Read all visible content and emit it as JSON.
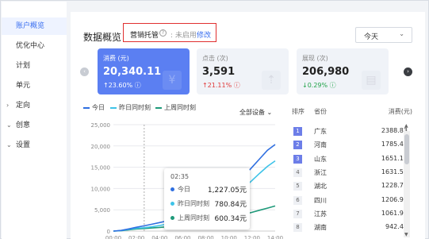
{
  "sidebar": {
    "items": [
      {
        "label": "账户概览",
        "active": true,
        "chevron": ""
      },
      {
        "label": "优化中心",
        "active": false,
        "chevron": ""
      },
      {
        "label": "计划",
        "active": false,
        "chevron": ""
      },
      {
        "label": "单元",
        "active": false,
        "chevron": ""
      },
      {
        "label": "定向",
        "active": false,
        "chevron": "›"
      },
      {
        "label": "创意",
        "active": false,
        "chevron": "⌄"
      },
      {
        "label": "设置",
        "active": false,
        "chevron": "⌄"
      }
    ]
  },
  "header": {
    "title": "数据概览",
    "hosting_label": "营销托管",
    "hosting_help": "?",
    "hosting_status": ": 未启用",
    "hosting_modify": "修改",
    "date_range": "今天",
    "date_arrow": "⌄"
  },
  "metrics": [
    {
      "label": "消费 (元)",
      "value": "20,340.11",
      "change": "↑23.60%",
      "change_note": "ⓘ",
      "direction": "up",
      "icon": "¥"
    },
    {
      "label": "点击 (次)",
      "value": "3,591",
      "change": "↑21.11%",
      "change_note": "ⓘ",
      "direction": "up",
      "icon": "⇡"
    },
    {
      "label": "展现 (次)",
      "value": "206,980",
      "change": "↓0.29%",
      "change_note": "ⓘ",
      "direction": "down",
      "icon": "▤"
    }
  ],
  "nav": {
    "prev": "‹",
    "next": "›"
  },
  "legend": {
    "items": [
      {
        "label": "今日",
        "color": "#2f6fe0"
      },
      {
        "label": "昨日同时刻",
        "color": "#3ec3e8"
      },
      {
        "label": "上周同时刻",
        "color": "#1f9a7a"
      }
    ],
    "device": "全部设备 ⌄"
  },
  "chart_data": {
    "type": "line",
    "x": [
      "00:00",
      "02:00",
      "04:00",
      "06:00",
      "08:00",
      "10:00",
      "12:00",
      "14:00"
    ],
    "ylim": [
      0,
      25000
    ],
    "yticks": [
      0,
      5000,
      10000,
      15000,
      20000,
      25000
    ],
    "ytick_labels": [
      "0",
      "5,000",
      "10,000",
      "15,000",
      "20,000",
      "25,000"
    ],
    "series": [
      {
        "name": "今日",
        "color": "#2f6fe0",
        "points": [
          [
            0,
            0
          ],
          [
            1,
            150
          ],
          [
            2,
            500
          ],
          [
            3,
            900
          ],
          [
            4,
            1227
          ],
          [
            5,
            1600
          ],
          [
            6,
            2000
          ],
          [
            7,
            2400
          ],
          [
            8,
            2900
          ],
          [
            9,
            3400
          ],
          [
            10,
            4000
          ],
          [
            11,
            4700
          ],
          [
            12,
            5500
          ],
          [
            13,
            6500
          ],
          [
            14,
            7700
          ],
          [
            15,
            9200
          ],
          [
            16,
            11000
          ],
          [
            17,
            13000
          ],
          [
            18,
            15000
          ],
          [
            19,
            17000
          ],
          [
            20,
            19000
          ],
          [
            21,
            20340
          ]
        ]
      },
      {
        "name": "昨日同时刻",
        "color": "#3ec3e8",
        "points": [
          [
            0,
            0
          ],
          [
            1,
            100
          ],
          [
            2,
            380
          ],
          [
            3,
            650
          ],
          [
            4,
            780
          ],
          [
            5,
            1000
          ],
          [
            6,
            1300
          ],
          [
            7,
            1650
          ],
          [
            8,
            2050
          ],
          [
            9,
            2500
          ],
          [
            10,
            3050
          ],
          [
            11,
            3650
          ],
          [
            12,
            4300
          ],
          [
            13,
            5100
          ],
          [
            14,
            6100
          ],
          [
            15,
            7300
          ],
          [
            16,
            8700
          ],
          [
            17,
            10200
          ],
          [
            18,
            11900
          ],
          [
            19,
            13600
          ],
          [
            20,
            15200
          ],
          [
            21,
            16500
          ]
        ]
      },
      {
        "name": "上周同时刻",
        "color": "#1f9a7a",
        "points": [
          [
            0,
            0
          ],
          [
            1,
            80
          ],
          [
            2,
            300
          ],
          [
            3,
            500
          ],
          [
            4,
            600
          ],
          [
            5,
            720
          ],
          [
            6,
            850
          ],
          [
            7,
            1000
          ],
          [
            8,
            1150
          ],
          [
            9,
            1350
          ],
          [
            10,
            1550
          ],
          [
            11,
            1800
          ],
          [
            12,
            2050
          ],
          [
            13,
            2350
          ],
          [
            14,
            2700
          ],
          [
            15,
            3100
          ],
          [
            16,
            3500
          ],
          [
            17,
            3950
          ],
          [
            18,
            4400
          ],
          [
            19,
            4900
          ],
          [
            20,
            5400
          ],
          [
            21,
            5900
          ]
        ]
      }
    ],
    "cursor_index": 4
  },
  "tooltip": {
    "time": "02:35",
    "rows": [
      {
        "name": "今日",
        "value": "1,227.05元",
        "color": "#2f6fe0"
      },
      {
        "name": "昨日同时刻",
        "value": "780.84元",
        "color": "#3ec3e8"
      },
      {
        "name": "上周同时刻",
        "value": "600.34元",
        "color": "#1f9a7a"
      }
    ]
  },
  "province_table": {
    "headers": {
      "rank": "排序",
      "province": "省份",
      "cost": "消费(元)"
    },
    "rows": [
      {
        "rank": "1",
        "province": "广东",
        "cost": "2388.83",
        "top": true
      },
      {
        "rank": "2",
        "province": "河南",
        "cost": "1785.48",
        "top": true
      },
      {
        "rank": "3",
        "province": "山东",
        "cost": "1651.12",
        "top": true
      },
      {
        "rank": "4",
        "province": "浙江",
        "cost": "1631.59",
        "top": false
      },
      {
        "rank": "5",
        "province": "湖北",
        "cost": "1228.76",
        "top": false
      },
      {
        "rank": "6",
        "province": "四川",
        "cost": "1206.90",
        "top": false
      },
      {
        "rank": "7",
        "province": "江苏",
        "cost": "1061.97",
        "top": false
      },
      {
        "rank": "8",
        "province": "湖南",
        "cost": "942.47",
        "top": false
      }
    ],
    "scroll_up": "▲",
    "scroll_down": "▼"
  }
}
